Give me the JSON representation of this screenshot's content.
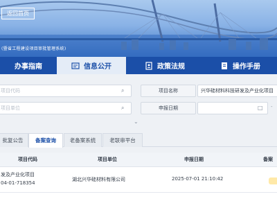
{
  "banner": {
    "back_label": "返回首页",
    "subtitle": "(暨省工程建设项目审批管理系统)"
  },
  "nav": {
    "items": [
      {
        "label": "办事指南",
        "icon": "guide-icon",
        "active": false
      },
      {
        "label": "信息公开",
        "icon": "info-icon",
        "active": true
      },
      {
        "label": "政策法规",
        "icon": "policy-icon",
        "active": false
      },
      {
        "label": "操作手册",
        "icon": "manual-icon",
        "active": false
      }
    ]
  },
  "search": {
    "code_placeholder": "项目代码",
    "unit_placeholder": "项目单位",
    "name_label": "项目名称",
    "name_value": "兴华硅材料科技研发及产业化项目",
    "date_label": "申报日期",
    "date_separator": "-"
  },
  "tabs": [
    {
      "label": "批复公告",
      "active": false
    },
    {
      "label": "备案查询",
      "active": true
    },
    {
      "label": "老备案系统",
      "active": false
    },
    {
      "label": "老联审平台",
      "active": false
    }
  ],
  "table": {
    "headers": [
      "项目代码",
      "项目单位",
      "申报日期",
      "备案"
    ],
    "rows": [
      {
        "name": "发及产业化项目",
        "code": "04-01-718354",
        "unit": "湖北兴华硅材料有限公司",
        "date": "2025-07-01 21:10:42"
      }
    ]
  },
  "colors": {
    "nav_bg": "#1b4fa8",
    "active_tab": "#1b4fa8",
    "status_badge": "#ffe9a8"
  }
}
